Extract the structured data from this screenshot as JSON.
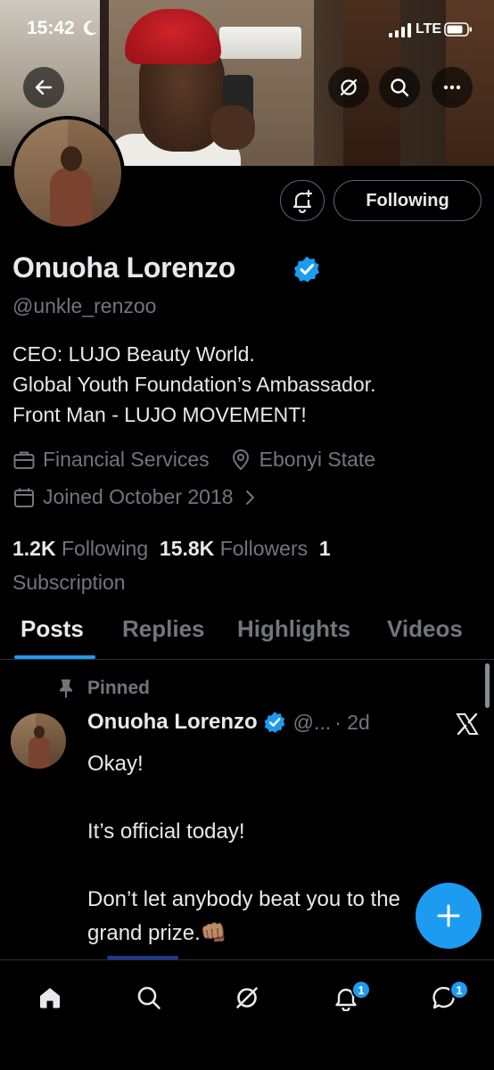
{
  "status_bar": {
    "time": "15:42",
    "network": "LTE"
  },
  "header": {
    "back_icon": "arrow-left-icon",
    "grok_icon": "grok-icon",
    "search_icon": "search-icon",
    "more_icon": "more-horizontal-icon"
  },
  "profile": {
    "display_name": "Onuoha Lorenzo",
    "handle": "@unkle_renzoo",
    "verified": true,
    "bio_lines": [
      "CEO: LUJO Beauty World.",
      "Global Youth Foundation’s Ambassador.",
      "Front Man - LUJO MOVEMENT!"
    ],
    "category": "Financial Services",
    "location": "Ebonyi State",
    "joined": "Joined October 2018",
    "following_count": "1.2K",
    "following_label": "Following",
    "followers_count": "15.8K",
    "followers_label": "Followers",
    "subscription_count": "1",
    "subscription_label": "Subscription",
    "follow_button": "Following"
  },
  "tabs": [
    {
      "label": "Posts",
      "active": true
    },
    {
      "label": "Replies",
      "active": false
    },
    {
      "label": "Highlights",
      "active": false
    },
    {
      "label": "Videos",
      "active": false
    }
  ],
  "pinned_post": {
    "pinned_label": "Pinned",
    "author": "Onuoha Lorenzo",
    "handle": "@...",
    "time": "· 2d",
    "text": "Okay!\n\nIt’s official today!\n\nDon’t let anybody beat you to the\ngrand prize.👊🏽"
  },
  "bottom_nav": {
    "items": [
      "home-icon",
      "search-icon",
      "grok-icon",
      "notifications-icon",
      "messages-icon"
    ],
    "notifications_badge": "1",
    "messages_badge": "1"
  },
  "colors": {
    "accent": "#1d9bf0",
    "background": "#000000",
    "text_primary": "#e7e9ea",
    "text_secondary": "#71767b"
  }
}
